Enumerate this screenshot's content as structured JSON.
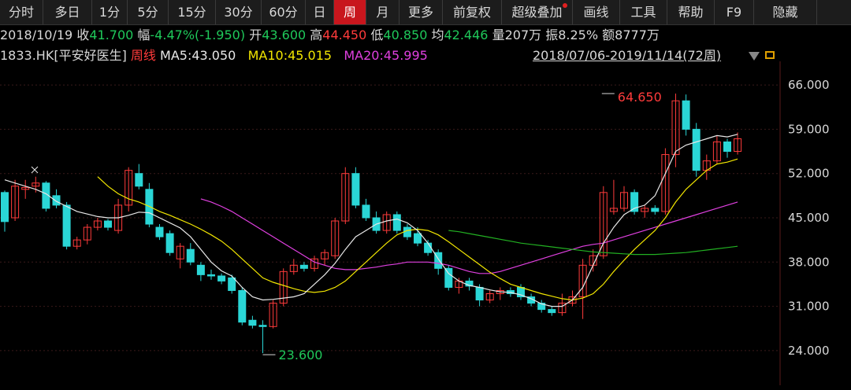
{
  "toolbar": {
    "tabs": [
      {
        "label": "分时",
        "w": 55
      },
      {
        "label": "多日",
        "w": 62
      },
      {
        "label": "1分",
        "w": 45
      },
      {
        "label": "5分",
        "w": 52
      },
      {
        "label": "15分",
        "w": 60
      },
      {
        "label": "30分",
        "w": 58
      },
      {
        "label": "60分",
        "w": 56
      },
      {
        "label": "日",
        "w": 36
      },
      {
        "label": "周",
        "w": 41,
        "active": true
      },
      {
        "label": "月",
        "w": 42
      },
      {
        "label": "更多",
        "w": 55
      },
      {
        "label": "前复权",
        "w": 75
      },
      {
        "label": "超级叠加",
        "w": 90,
        "dot": true
      },
      {
        "label": "画线",
        "w": 60
      },
      {
        "label": "工具",
        "w": 60
      },
      {
        "label": "帮助",
        "w": 60
      },
      {
        "label": "F9",
        "w": 50
      },
      {
        "label": "隐藏",
        "w": 80
      }
    ]
  },
  "quote": {
    "date": "2018/10/19",
    "close_label": "收",
    "close": "41.700",
    "change_label": "幅",
    "change": "-4.47%(-1.950)",
    "open_label": "开",
    "open": "43.600",
    "high_label": "高",
    "high": "44.450",
    "low_label": "低",
    "low": "40.850",
    "avg_label": "均",
    "avg": "42.446",
    "volume_label": "量",
    "volume": "207万",
    "amplitude_label": "振",
    "amplitude": "8.25%",
    "amount_label": "额",
    "amount": "8777万"
  },
  "info": {
    "code": "1833.HK",
    "name": "[平安好医生]",
    "period": "周线",
    "ma5": "MA5:43.050",
    "ma10": "MA10:45.015",
    "ma20": "MA20:45.995",
    "range": "2018/07/06-2019/11/14(72周)"
  },
  "colors": {
    "up": "#ff3b3b",
    "down": "#2ad6d6",
    "ma5": "#e8e8e8",
    "ma10": "#f2e600",
    "ma20": "#e040e0",
    "ma_long": "#22b022",
    "grid": "#3a1a1a"
  },
  "chart_data": {
    "type": "candlestick",
    "ylim": [
      21.0,
      68.5
    ],
    "yticks": [
      "66.000",
      "59.000",
      "52.000",
      "45.000",
      "38.000",
      "31.000",
      "24.000"
    ],
    "ytick_values": [
      66,
      59,
      52,
      45,
      38,
      31,
      24
    ],
    "annotations": {
      "max_label": "64.650",
      "max_index": 58,
      "min_label": "23.600",
      "min_index": 22
    },
    "candles": [
      {
        "o": 49.0,
        "h": 49.3,
        "l": 42.8,
        "c": 44.4
      },
      {
        "o": 45.0,
        "h": 51.0,
        "l": 44.5,
        "c": 50.0
      },
      {
        "o": 49.5,
        "h": 51.0,
        "l": 48.0,
        "c": 49.8
      },
      {
        "o": 50.0,
        "h": 51.5,
        "l": 49.0,
        "c": 50.5
      },
      {
        "o": 50.5,
        "h": 50.8,
        "l": 46.0,
        "c": 46.5
      },
      {
        "o": 48.5,
        "h": 49.5,
        "l": 46.5,
        "c": 47.0
      },
      {
        "o": 47.0,
        "h": 47.5,
        "l": 40.0,
        "c": 40.5
      },
      {
        "o": 40.5,
        "h": 42.0,
        "l": 40.0,
        "c": 41.5
      },
      {
        "o": 41.5,
        "h": 44.0,
        "l": 40.8,
        "c": 43.5
      },
      {
        "o": 43.5,
        "h": 45.0,
        "l": 43.0,
        "c": 44.5
      },
      {
        "o": 44.5,
        "h": 44.8,
        "l": 43.0,
        "c": 43.5
      },
      {
        "o": 43.0,
        "h": 48.0,
        "l": 42.5,
        "c": 47.0
      },
      {
        "o": 47.0,
        "h": 53.0,
        "l": 46.0,
        "c": 52.5
      },
      {
        "o": 52.0,
        "h": 53.5,
        "l": 49.5,
        "c": 50.0
      },
      {
        "o": 49.5,
        "h": 50.5,
        "l": 43.5,
        "c": 44.0
      },
      {
        "o": 43.5,
        "h": 44.0,
        "l": 41.5,
        "c": 42.0
      },
      {
        "o": 42.5,
        "h": 43.0,
        "l": 39.0,
        "c": 39.5
      },
      {
        "o": 38.5,
        "h": 41.0,
        "l": 37.0,
        "c": 40.5
      },
      {
        "o": 40.0,
        "h": 41.0,
        "l": 37.5,
        "c": 38.0
      },
      {
        "o": 37.5,
        "h": 38.0,
        "l": 35.0,
        "c": 36.0
      },
      {
        "o": 36.0,
        "h": 36.8,
        "l": 35.2,
        "c": 35.8
      },
      {
        "o": 35.8,
        "h": 36.2,
        "l": 34.5,
        "c": 35.0
      },
      {
        "o": 35.5,
        "h": 36.0,
        "l": 33.0,
        "c": 33.5
      },
      {
        "o": 33.5,
        "h": 34.0,
        "l": 28.0,
        "c": 28.5
      },
      {
        "o": 28.8,
        "h": 29.5,
        "l": 27.5,
        "c": 28.0
      },
      {
        "o": 28.0,
        "h": 28.8,
        "l": 23.6,
        "c": 27.8
      },
      {
        "o": 27.8,
        "h": 32.0,
        "l": 27.5,
        "c": 31.5
      },
      {
        "o": 31.5,
        "h": 37.0,
        "l": 31.0,
        "c": 36.5
      },
      {
        "o": 36.5,
        "h": 38.5,
        "l": 36.0,
        "c": 37.5
      },
      {
        "o": 37.5,
        "h": 38.0,
        "l": 36.5,
        "c": 37.0
      },
      {
        "o": 37.0,
        "h": 39.0,
        "l": 36.5,
        "c": 38.5
      },
      {
        "o": 38.5,
        "h": 40.0,
        "l": 37.5,
        "c": 39.5
      },
      {
        "o": 39.0,
        "h": 45.0,
        "l": 38.5,
        "c": 44.5
      },
      {
        "o": 44.5,
        "h": 53.0,
        "l": 44.0,
        "c": 52.0
      },
      {
        "o": 52.0,
        "h": 53.0,
        "l": 46.5,
        "c": 47.0
      },
      {
        "o": 47.0,
        "h": 48.0,
        "l": 44.5,
        "c": 45.0
      },
      {
        "o": 45.0,
        "h": 46.0,
        "l": 42.5,
        "c": 43.0
      },
      {
        "o": 43.0,
        "h": 46.0,
        "l": 42.5,
        "c": 45.5
      },
      {
        "o": 45.5,
        "h": 46.0,
        "l": 42.5,
        "c": 43.0
      },
      {
        "o": 43.5,
        "h": 44.0,
        "l": 41.5,
        "c": 42.0
      },
      {
        "o": 42.5,
        "h": 43.5,
        "l": 40.5,
        "c": 41.0
      },
      {
        "o": 41.0,
        "h": 41.5,
        "l": 39.0,
        "c": 39.5
      },
      {
        "o": 39.5,
        "h": 40.0,
        "l": 36.0,
        "c": 37.0
      },
      {
        "o": 37.0,
        "h": 37.5,
        "l": 33.5,
        "c": 34.0
      },
      {
        "o": 34.0,
        "h": 35.5,
        "l": 33.0,
        "c": 35.0
      },
      {
        "o": 35.0,
        "h": 35.5,
        "l": 33.5,
        "c": 34.2
      },
      {
        "o": 34.0,
        "h": 34.5,
        "l": 31.0,
        "c": 32.0
      },
      {
        "o": 32.0,
        "h": 33.5,
        "l": 31.5,
        "c": 33.0
      },
      {
        "o": 33.0,
        "h": 34.0,
        "l": 32.0,
        "c": 33.5
      },
      {
        "o": 33.5,
        "h": 34.0,
        "l": 32.5,
        "c": 33.0
      },
      {
        "o": 34.0,
        "h": 34.5,
        "l": 32.0,
        "c": 32.5
      },
      {
        "o": 32.5,
        "h": 33.0,
        "l": 31.0,
        "c": 31.5
      },
      {
        "o": 31.5,
        "h": 32.0,
        "l": 30.0,
        "c": 30.5
      },
      {
        "o": 30.5,
        "h": 31.0,
        "l": 29.5,
        "c": 30.0
      },
      {
        "o": 30.0,
        "h": 33.0,
        "l": 29.5,
        "c": 31.5
      },
      {
        "o": 31.5,
        "h": 33.5,
        "l": 31.0,
        "c": 32.5
      },
      {
        "o": 32.5,
        "h": 38.5,
        "l": 29.0,
        "c": 37.5
      },
      {
        "o": 37.5,
        "h": 40.0,
        "l": 36.5,
        "c": 39.0
      },
      {
        "o": 39.0,
        "h": 50.0,
        "l": 38.5,
        "c": 49.0
      },
      {
        "o": 46.0,
        "h": 51.0,
        "l": 45.5,
        "c": 46.5
      },
      {
        "o": 46.5,
        "h": 50.0,
        "l": 46.0,
        "c": 49.0
      },
      {
        "o": 49.0,
        "h": 49.5,
        "l": 45.5,
        "c": 46.0
      },
      {
        "o": 46.0,
        "h": 47.0,
        "l": 45.0,
        "c": 46.5
      },
      {
        "o": 46.5,
        "h": 47.0,
        "l": 45.5,
        "c": 46.0
      },
      {
        "o": 46.0,
        "h": 56.0,
        "l": 45.5,
        "c": 55.0
      },
      {
        "o": 55.0,
        "h": 64.65,
        "l": 53.0,
        "c": 63.5
      },
      {
        "o": 63.5,
        "h": 64.5,
        "l": 58.0,
        "c": 59.0
      },
      {
        "o": 59.0,
        "h": 60.0,
        "l": 51.5,
        "c": 52.5
      },
      {
        "o": 52.5,
        "h": 55.0,
        "l": 51.0,
        "c": 54.0
      },
      {
        "o": 54.0,
        "h": 58.0,
        "l": 53.5,
        "c": 57.0
      },
      {
        "o": 57.0,
        "h": 57.5,
        "l": 54.5,
        "c": 55.5
      },
      {
        "o": 55.5,
        "h": 58.5,
        "l": 55.0,
        "c": 57.5
      }
    ],
    "ma5": [
      51.0,
      50.5,
      50.0,
      49.5,
      48.8,
      47.6,
      46.8,
      46.0,
      45.6,
      45.2,
      45.0,
      45.0,
      45.4,
      45.9,
      45.8,
      45.0,
      44.2,
      43.4,
      42.0,
      40.0,
      38.0,
      36.6,
      35.8,
      34.0,
      32.5,
      32.0,
      32.1,
      32.3,
      32.5,
      33.0,
      34.5,
      36.0,
      37.8,
      40.0,
      42.0,
      43.0,
      44.0,
      44.5,
      44.8,
      44.2,
      43.0,
      41.0,
      38.5,
      36.2,
      35.0,
      34.3,
      34.0,
      33.6,
      33.3,
      33.2,
      32.8,
      32.2,
      31.4,
      31.0,
      31.0,
      32.0,
      34.0,
      37.5,
      41.0,
      43.5,
      45.5,
      46.5,
      47.0,
      48.5,
      52.0,
      55.5,
      56.5,
      57.0,
      57.5,
      58.0,
      57.8,
      58.2
    ],
    "ma10": [
      null,
      null,
      null,
      null,
      null,
      null,
      null,
      null,
      null,
      51.5,
      50.0,
      48.8,
      48.0,
      47.5,
      46.8,
      46.0,
      45.4,
      44.7,
      44.0,
      43.2,
      42.3,
      41.3,
      40.0,
      38.5,
      37.0,
      35.5,
      34.8,
      34.3,
      33.8,
      33.4,
      33.2,
      33.4,
      34.0,
      35.0,
      36.5,
      38.0,
      39.5,
      41.0,
      42.3,
      43.0,
      43.2,
      43.0,
      42.3,
      41.2,
      40.0,
      38.8,
      37.6,
      36.4,
      35.4,
      34.5,
      34.0,
      33.5,
      33.0,
      32.6,
      32.2,
      32.0,
      32.3,
      33.0,
      34.5,
      36.5,
      38.3,
      40.0,
      41.5,
      43.0,
      45.0,
      47.5,
      49.5,
      51.0,
      52.5,
      53.5,
      53.8,
      54.3
    ],
    "ma20": [
      null,
      null,
      null,
      null,
      null,
      null,
      null,
      null,
      null,
      null,
      null,
      null,
      null,
      null,
      null,
      null,
      null,
      null,
      null,
      48.0,
      47.5,
      46.8,
      46.0,
      45.0,
      44.0,
      43.0,
      42.0,
      41.0,
      40.0,
      39.0,
      38.0,
      37.5,
      37.0,
      36.8,
      36.8,
      37.0,
      37.2,
      37.5,
      37.7,
      38.0,
      38.0,
      38.0,
      37.8,
      37.5,
      37.0,
      36.5,
      36.2,
      36.2,
      36.5,
      37.0,
      37.5,
      38.0,
      38.5,
      39.0,
      39.5,
      40.0,
      40.5,
      40.8,
      41.0,
      41.5,
      42.0,
      42.5,
      43.0,
      43.5,
      44.0,
      44.5,
      45.0,
      45.5,
      46.0,
      46.5,
      47.0,
      47.5
    ],
    "ma_long": []
  }
}
